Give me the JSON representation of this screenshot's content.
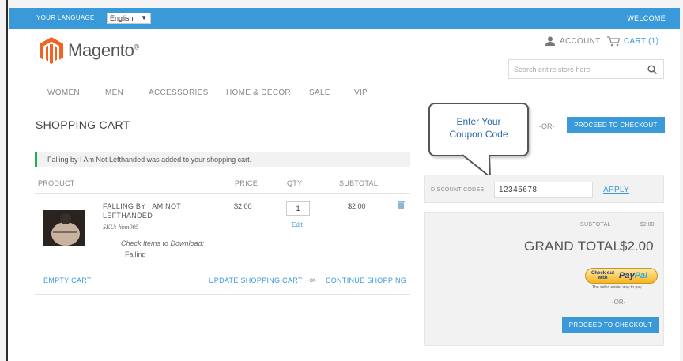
{
  "topbar": {
    "language_label": "YOUR LANGUAGE",
    "language_value": "English",
    "welcome": "WELCOME"
  },
  "logo": {
    "brand": "Magento",
    "trademark": "®"
  },
  "header": {
    "account_label": "ACCOUNT",
    "cart_label": "CART (1)",
    "search_placeholder": "Search entire store here"
  },
  "nav": {
    "items": [
      "WOMEN",
      "MEN",
      "ACCESSORIES",
      "HOME & DECOR",
      "SALE",
      "VIP"
    ]
  },
  "page": {
    "title": "SHOPPING CART"
  },
  "message": {
    "text": "Falling by I Am Not Lefthanded was added to your shopping cart."
  },
  "table": {
    "headers": {
      "product": "PRODUCT",
      "price": "PRICE",
      "qty": "QTY",
      "subtotal": "SUBTOTAL"
    },
    "rows": [
      {
        "name_line1": "FALLING BY I AM NOT",
        "name_line2": "LEFTHANDED",
        "sku": "SKU: hbm005",
        "download_label": "Check Items to Download:",
        "download_item": "Falling",
        "price": "$2.00",
        "qty": "1",
        "edit": "Edit",
        "subtotal": "$2.00"
      }
    ]
  },
  "actions": {
    "empty_cart": "EMPTY CART",
    "update_cart": "UPDATE SHOPPING CART",
    "or": "-or-",
    "continue": "CONTINUE SHOPPING"
  },
  "callout": {
    "line1": "Enter Your",
    "line2": "Coupon Code"
  },
  "checkout_top": {
    "or": "-OR-",
    "button": "PROCEED TO CHECKOUT"
  },
  "discount": {
    "label": "DISCOUNT CODES",
    "code": "12345678",
    "apply": "APPLY"
  },
  "totals": {
    "subtotal_label": "SUBTOTAL",
    "subtotal_value": "$2.00",
    "grand_total_label": "GRAND TOTAL",
    "grand_total_value": "$2.00",
    "paypal_check": "Check out",
    "paypal_with": "with",
    "paypal_logo_a": "Pay",
    "paypal_logo_b": "Pal",
    "paypal_tagline": "The safer, easier way to pay",
    "or": "-OR-",
    "checkout_button": "PROCEED TO CHECKOUT"
  },
  "colors": {
    "accent": "#3a9ad9",
    "success": "#22b14c",
    "brand_orange": "#f26322"
  }
}
